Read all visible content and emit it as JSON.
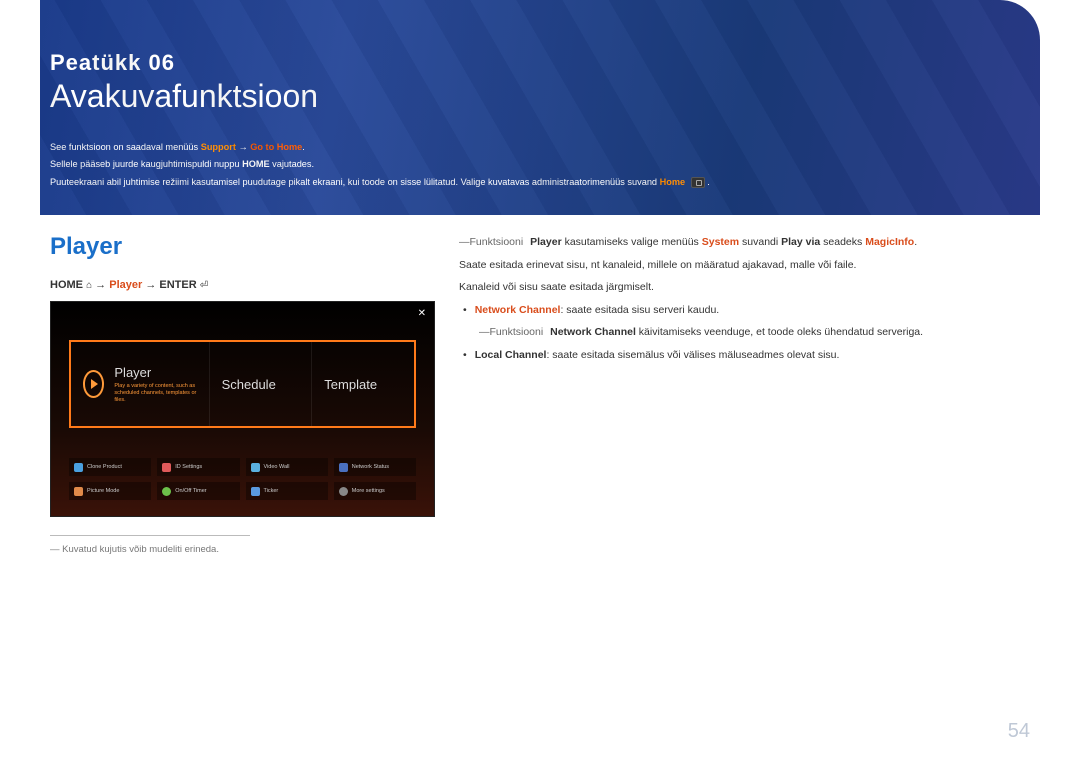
{
  "hero": {
    "chapter": "Peatükk  06",
    "title": "Avakuvafunktsioon",
    "line1_a": "See funktsioon on saadaval menüüs ",
    "line1_support": "Support",
    "line1_arrow": " → ",
    "line1_go": "Go to Home",
    "line1_dot": ".",
    "line2_a": "Sellele pääseb juurde kaugjuhtimispuldi nuppu ",
    "line2_home": "HOME",
    "line2_b": " vajutades.",
    "line3_a": "Puuteekraani abil juhtimise režiimi kasutamisel puudutage pikalt ekraani, kui toode on sisse lülitatud. Valige kuvatavas administraatorimenüüs suvand ",
    "line3_home": "Home"
  },
  "section_title": "Player",
  "crumb": {
    "home": "HOME",
    "player": "Player",
    "enter": "ENTER"
  },
  "screen": {
    "close": "✕",
    "player": "Player",
    "player_sub": "Play a variety of content, such as scheduled channels, templates or files.",
    "schedule": "Schedule",
    "template": "Template",
    "g": {
      "clone": "Clone Product",
      "id": "ID Settings",
      "video": "Video Wall",
      "net": "Network Status",
      "picture": "Picture Mode",
      "onoff": "On/Off Timer",
      "ticker": "Ticker",
      "more": "More settings"
    }
  },
  "footnote": "― Kuvatud kujutis võib mudeliti erineda.",
  "right": {
    "p1_a": "―Funktsiooni ",
    "p1_player": "Player",
    "p1_b": " kasutamiseks valige menüüs ",
    "p1_system": "System",
    "p1_c": " suvandi ",
    "p1_playvia": "Play via",
    "p1_d": " seadeks ",
    "p1_magic": "MagicInfo",
    "p1_e": ".",
    "p2": "Saate esitada erinevat sisu, nt kanaleid, millele on määratud ajakavad, malle või faile.",
    "p3": "Kanaleid või sisu saate esitada järgmiselt.",
    "b1_label": "Network Channel",
    "b1_text": ": saate esitada sisu serveri kaudu.",
    "b1_sub_a": "―Funktsiooni ",
    "b1_sub_nc": "Network Channel",
    "b1_sub_b": " käivitamiseks veenduge, et toode oleks ühendatud serveriga.",
    "b2_label": "Local Channel",
    "b2_text": ": saate esitada sisemälus või välises mäluseadmes olevat sisu."
  },
  "page_num": "54"
}
